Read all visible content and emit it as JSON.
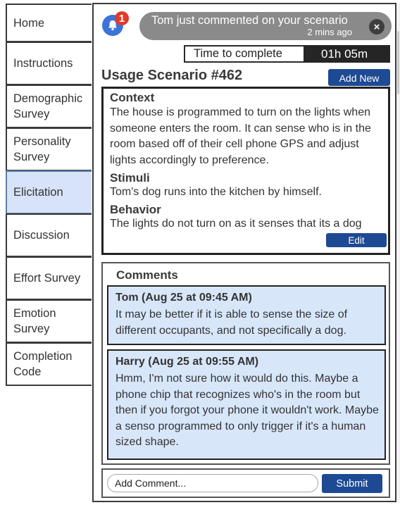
{
  "sidebar": {
    "items": [
      {
        "label": "Home",
        "active": false
      },
      {
        "label": "Instructions",
        "active": false
      },
      {
        "label": "Demographic Survey",
        "active": false
      },
      {
        "label": "Personality Survey",
        "active": false
      },
      {
        "label": "Elicitation",
        "active": true
      },
      {
        "label": "Discussion",
        "active": false
      },
      {
        "label": "Effort Survey",
        "active": false
      },
      {
        "label": "Emotion Survey",
        "active": false
      },
      {
        "label": "Completion Code",
        "active": false
      }
    ]
  },
  "notification": {
    "icon": "bell-icon",
    "badge_count": "1",
    "message": "Tom just commented on your scenario",
    "time": "2 mins ago",
    "close_icon": "close-icon"
  },
  "timer": {
    "label": "Time to complete",
    "value": "01h 05m"
  },
  "scenario": {
    "title": "Usage Scenario #462",
    "add_new_label": "Add New",
    "edit_label": "Edit",
    "context_heading": "Context",
    "context_text": "The house is programmed to turn on the lights when someone enters the room. It can sense who is in the room based off of their cell phone GPS and adjust lights accordingly to preference.",
    "stimuli_heading": "Stimuli",
    "stimuli_text": "Tom's dog runs into the kitchen by himself.",
    "behavior_heading": "Behavior",
    "behavior_text": "The lights do not turn on as it senses that its a dog"
  },
  "comments": {
    "title": "Comments",
    "items": [
      {
        "author": "Tom (Aug 25 at 09:45 AM)",
        "text": "It may be better if it is able to sense the size of different occupants, and not specifically a dog."
      },
      {
        "author": "Harry (Aug 25 at 09:55 AM)",
        "text": "Hmm, I'm not sure how it would do this. Maybe a phone chip that recognizes who's in the room but then if you forgot your phone it wouldn't work. Maybe a senso programmed to only trigger if it's a human sized shape."
      }
    ],
    "input_placeholder": "Add Comment...",
    "submit_label": "Submit"
  },
  "colors": {
    "accent": "#1d4a93",
    "active_nav": "#d6e3f8",
    "comment_bg": "#d8e6fa",
    "badge": "#e03a2a",
    "bell": "#3c73d9",
    "toast": "#8a8a8a"
  }
}
